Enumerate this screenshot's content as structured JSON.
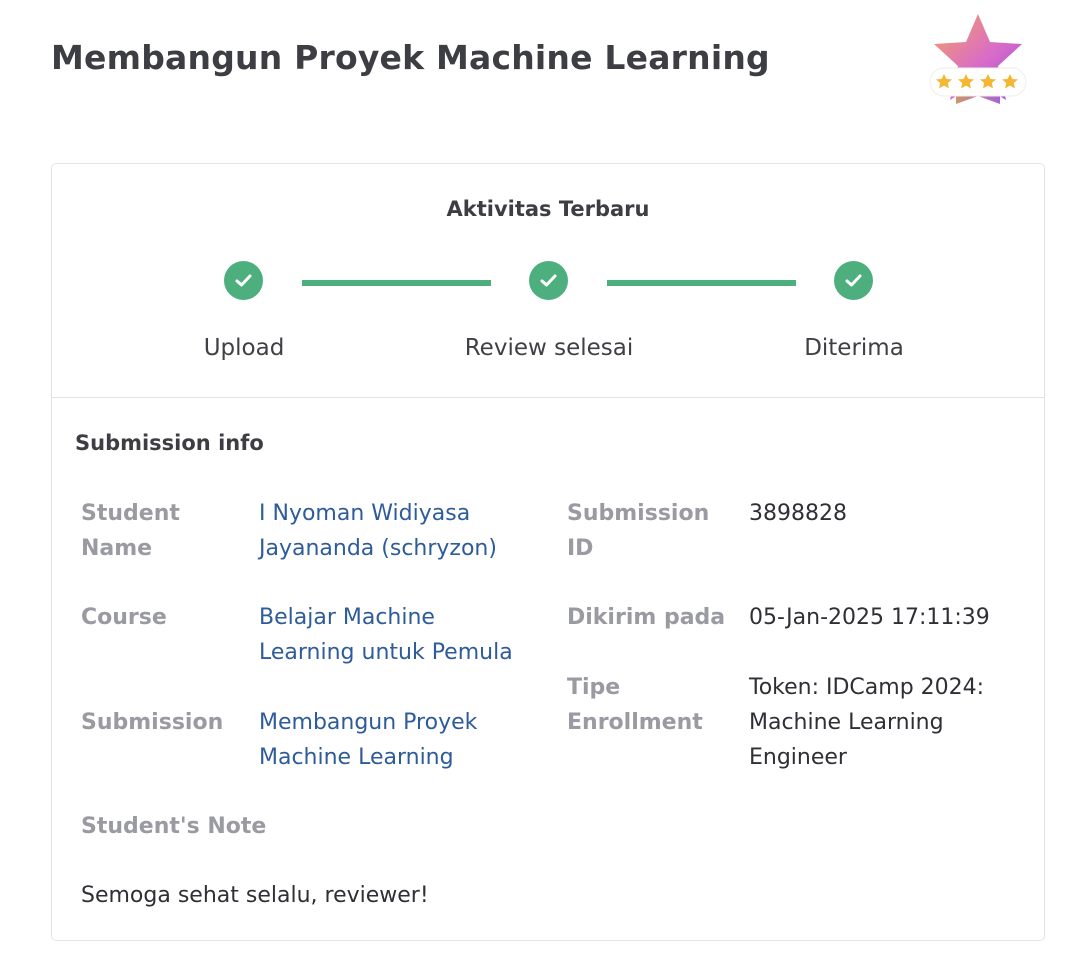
{
  "header": {
    "title": "Membangun Proyek Machine Learning",
    "rating_stars": 4
  },
  "activity": {
    "title": "Aktivitas Terbaru",
    "steps": [
      {
        "label": "Upload",
        "status": "done"
      },
      {
        "label": "Review selesai",
        "status": "done"
      },
      {
        "label": "Diterima",
        "status": "done"
      }
    ]
  },
  "submission_info": {
    "title": "Submission info",
    "student_name_label_line1": "Student",
    "student_name_label_line2": "Name",
    "student_name_line1": "I Nyoman Widiyasa",
    "student_name_line2": "Jayananda (schryzon)",
    "submission_id_label_line1": "Submission",
    "submission_id_label_line2": "ID",
    "submission_id": "3898828",
    "course_label": "Course",
    "course_line1": "Belajar Machine",
    "course_line2": "Learning untuk Pemula",
    "sent_at_label": "Dikirim pada",
    "sent_at": "05-Jan-2025 17:11:39",
    "enrollment_label_line1": "Tipe",
    "enrollment_label_line2": "Enrollment",
    "enrollment_line1": "Token: IDCamp 2024:",
    "enrollment_line2": "Machine Learning",
    "enrollment_line3": "Engineer",
    "submission_label": "Submission",
    "submission_line1": "Membangun Proyek",
    "submission_line2": "Machine Learning",
    "note_label": "Student's Note",
    "note": "Semoga sehat selalu, reviewer!"
  },
  "colors": {
    "success": "#4caf7d",
    "link": "#2e5b9a",
    "label": "#9a9aa2"
  }
}
